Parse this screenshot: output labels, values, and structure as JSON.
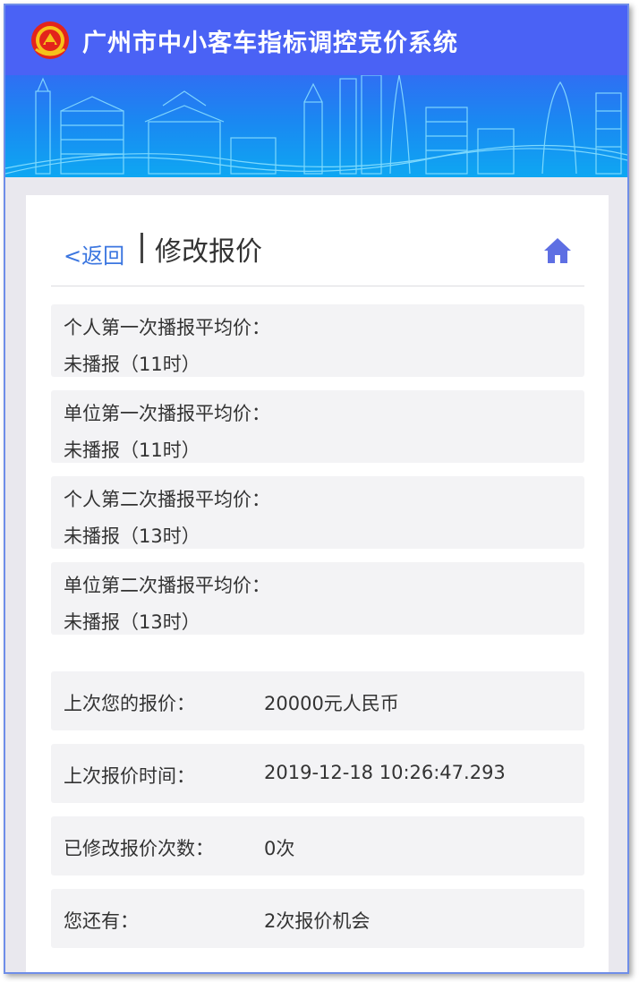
{
  "header": {
    "system_title": "广州市中小客车指标调控竞价系统",
    "logo_icon": "emblem-icon",
    "brand_color": "#4a62f5"
  },
  "nav": {
    "back_label": "<返回",
    "page_title": "修改报价",
    "home_icon": "home-icon",
    "accent_color": "#3b76e0"
  },
  "averages": [
    {
      "label": "个人第一次播报平均价：",
      "value": "未播报（11时）"
    },
    {
      "label": "单位第一次播报平均价：",
      "value": "未播报（11时）"
    },
    {
      "label": "个人第二次播报平均价：",
      "value": "未播报（13时）"
    },
    {
      "label": "单位第二次播报平均价：",
      "value": "未播报（13时）"
    }
  ],
  "info": [
    {
      "label": "上次您的报价：",
      "value": "20000元人民币"
    },
    {
      "label": "上次报价时间：",
      "value": "2019-12-18 10:26:47.293"
    },
    {
      "label": "已修改报价次数：",
      "value": "0次"
    },
    {
      "label": "您还有：",
      "value": "2次报价机会"
    }
  ]
}
